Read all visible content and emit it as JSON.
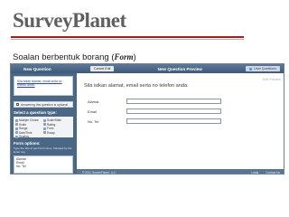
{
  "slide": {
    "brand": "SurveyPlanet",
    "heading_prefix": "Soalan berbentuk borang (",
    "heading_form_word": "Form",
    "heading_suffix": ")"
  },
  "app": {
    "tab_new_question": "New Question",
    "cancel_label": "Cancel Edit",
    "tab_preview": "New Question Preview",
    "user_settings_label": "User Questions"
  },
  "sidebar": {
    "question_text": "Sila isikan alamat, email serta no telefon anda:",
    "answering_optional_label": "Answering this question is optional",
    "select_type_title": "Select a question type:",
    "types": [
      "Multiple Choice",
      "Scale",
      "Range",
      "Date/Time",
      "Scoring",
      "Scale/Slide",
      "Rating",
      "Form",
      "Essay"
    ],
    "form_options_title": "Form options:",
    "form_options_note": "Type the title of each form item, followed by the Enter key.",
    "form_items": [
      "Alamat",
      "Email",
      "No. Tel"
    ]
  },
  "preview": {
    "edit_preview_label": "Edit Preview",
    "question": "Sila isikan alamat, email serta no telefon anda:",
    "fields": [
      {
        "label": "Alamat"
      },
      {
        "label": "Email"
      },
      {
        "label": "No. Tel"
      }
    ],
    "footer_copyright": "© 2011 SurveyPlanet, LLC",
    "footer_links": [
      "Legal",
      "Contact Us"
    ]
  }
}
